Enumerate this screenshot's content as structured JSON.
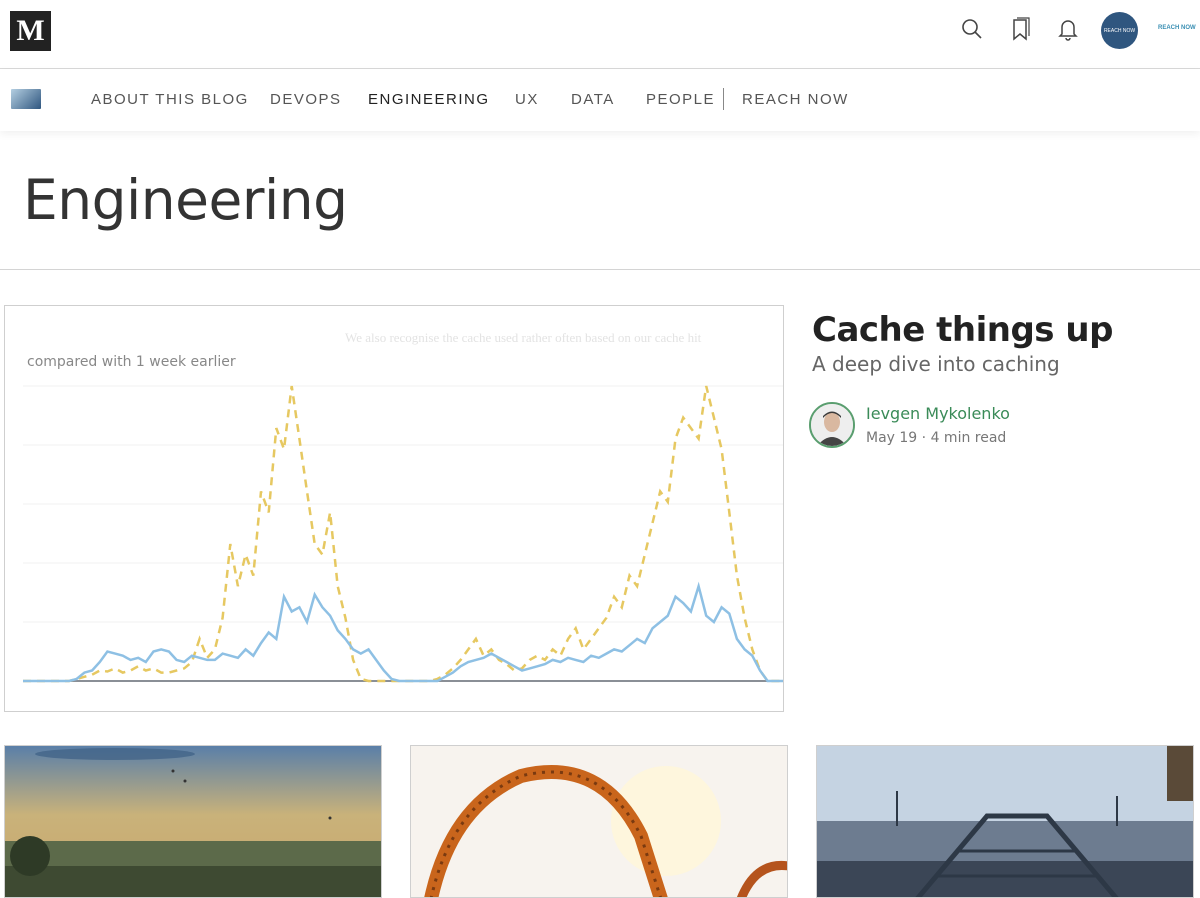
{
  "top": {
    "logo_text": "M",
    "brand_small": "REACH NOW",
    "avatar_text": "REACH NOW",
    "icons": [
      "search-icon",
      "bookmarks-icon",
      "bell-icon"
    ]
  },
  "nav": {
    "items": [
      "ABOUT THIS BLOG",
      "DEVOPS",
      "ENGINEERING",
      "UX",
      "DATA",
      "PEOPLE",
      "REACH NOW"
    ],
    "active": "ENGINEERING"
  },
  "page": {
    "title": "Engineering"
  },
  "featured": {
    "chart_caption": "compared with 1 week earlier",
    "faded_text": "We also recognise the cache used rather often based on our cache hit",
    "title": "Cache things up",
    "subtitle": "A deep dive into caching",
    "author": "Ievgen Mykolenko",
    "date": "May 19",
    "read_time": "4 min read"
  },
  "chart_data": {
    "type": "line",
    "title": "",
    "xlabel": "",
    "ylabel": "",
    "x": [
      0,
      1,
      2,
      3,
      4,
      5,
      6,
      7,
      8,
      9,
      10,
      11,
      12,
      13,
      14,
      15,
      16,
      17,
      18,
      19,
      20,
      21,
      22,
      23,
      24,
      25,
      26,
      27,
      28,
      29,
      30,
      31,
      32,
      33,
      34,
      35,
      36,
      37,
      38,
      39,
      40,
      41,
      42,
      43,
      44,
      45,
      46,
      47,
      48,
      49,
      50,
      51,
      52,
      53,
      54,
      55,
      56,
      57,
      58,
      59,
      60,
      61,
      62,
      63,
      64,
      65,
      66,
      67,
      68,
      69,
      70,
      71,
      72,
      73,
      74,
      75,
      76,
      77,
      78,
      79,
      80,
      81,
      82,
      83,
      84,
      85,
      86,
      87,
      88,
      89,
      90,
      91,
      92,
      93,
      94,
      95,
      96,
      97,
      98,
      99
    ],
    "series": [
      {
        "values": [
          0,
          0,
          0,
          0,
          0,
          0,
          0,
          2,
          4,
          6,
          10,
          9,
          12,
          8,
          10,
          14,
          10,
          12,
          8,
          8,
          10,
          12,
          18,
          40,
          22,
          30,
          60,
          130,
          90,
          120,
          100,
          180,
          160,
          240,
          220,
          280,
          230,
          180,
          130,
          120,
          160,
          90,
          60,
          20,
          2,
          0,
          0,
          0,
          0,
          0,
          0,
          0,
          0,
          0,
          2,
          6,
          12,
          20,
          30,
          40,
          24,
          30,
          20,
          16,
          10,
          12,
          20,
          24,
          20,
          30,
          24,
          40,
          50,
          30,
          40,
          50,
          60,
          80,
          70,
          100,
          90,
          120,
          150,
          180,
          170,
          230,
          250,
          240,
          230,
          280,
          250,
          220,
          160,
          100,
          60,
          30,
          10,
          0,
          0,
          0
        ],
        "color": "#e6c861",
        "style": "dashed"
      },
      {
        "values": [
          0,
          0,
          0,
          0,
          0,
          0,
          0,
          2,
          8,
          10,
          18,
          28,
          26,
          24,
          20,
          22,
          18,
          28,
          30,
          28,
          20,
          18,
          24,
          22,
          20,
          20,
          26,
          24,
          22,
          30,
          24,
          36,
          46,
          40,
          80,
          66,
          70,
          56,
          82,
          70,
          62,
          48,
          40,
          30,
          26,
          30,
          20,
          10,
          2,
          0,
          0,
          0,
          0,
          0,
          0,
          4,
          8,
          14,
          18,
          20,
          22,
          26,
          22,
          18,
          14,
          10,
          12,
          14,
          16,
          20,
          18,
          22,
          20,
          18,
          24,
          22,
          26,
          30,
          28,
          34,
          40,
          36,
          50,
          56,
          62,
          80,
          74,
          66,
          90,
          62,
          56,
          70,
          64,
          40,
          30,
          24,
          10,
          0,
          0,
          0
        ],
        "color": "#8ec0e4",
        "style": "solid"
      }
    ],
    "grid": true,
    "legend": "none"
  },
  "cards": [
    {
      "colors": [
        "#5a7fa8",
        "#c9a66b",
        "#4d5a3e"
      ]
    },
    {
      "colors": [
        "#ffffff",
        "#d9782b",
        "#b5541d"
      ]
    },
    {
      "colors": [
        "#c5d3e2",
        "#5f6f86",
        "#2d3846"
      ]
    }
  ]
}
